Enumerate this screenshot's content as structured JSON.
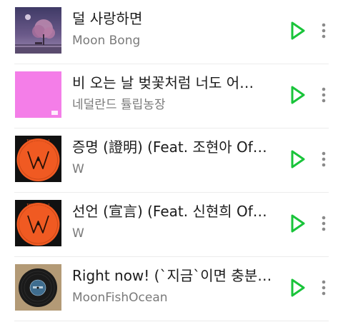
{
  "colors": {
    "accent": "#19c43a",
    "title": "#1c1c1c",
    "subtitle": "#7a7a7a",
    "divider": "#ececec",
    "more": "#8a8a8a"
  },
  "tracks": [
    {
      "title": "덜 사랑하면",
      "artist": "Moon Bong",
      "art": "purple-night-tree-cover"
    },
    {
      "title": "비 오는 날 벚꽃처럼 너도 어…",
      "artist": "네덜란드 튤립농장",
      "art": "pink-square-cover"
    },
    {
      "title": "증명 (證明) (Feat. 조현아 Of…",
      "artist": "W",
      "art": "orange-vinyl-cover",
      "art_text": "W & Jewel"
    },
    {
      "title": "선언 (宣言) (Feat. 신현희 Of…",
      "artist": "W",
      "art": "orange-vinyl-cover",
      "art_text": "W & Jewel"
    },
    {
      "title": "Right now! (`지금`이면 충분…",
      "artist": "MoonFishOcean",
      "art": "black-vinyl-cover"
    }
  ],
  "actions": {
    "play_icon": "play-icon",
    "more_icon": "more-vertical-icon"
  }
}
